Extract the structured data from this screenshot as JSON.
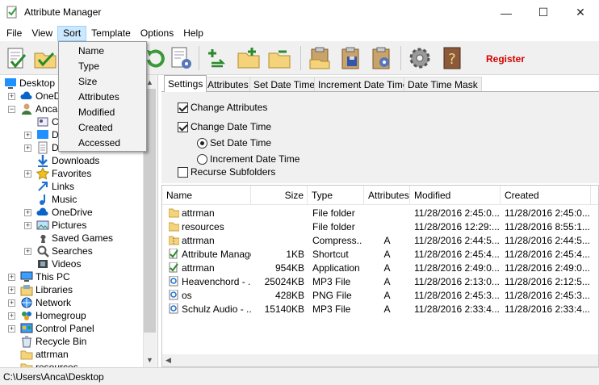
{
  "window": {
    "title": "Attribute Manager"
  },
  "menubar": [
    "File",
    "View",
    "Sort",
    "Template",
    "Options",
    "Help"
  ],
  "sort_menu": [
    "Name",
    "Type",
    "Size",
    "Attributes",
    "Modified",
    "Created",
    "Accessed"
  ],
  "toolbar": {
    "register_label": "Register"
  },
  "tree": [
    {
      "label": "Desktop"
    },
    {
      "label": "OneD"
    },
    {
      "label": "Anca"
    },
    {
      "label": "C"
    },
    {
      "label": "D"
    },
    {
      "label": "D"
    },
    {
      "label": "Downloads"
    },
    {
      "label": "Favorites"
    },
    {
      "label": "Links"
    },
    {
      "label": "Music"
    },
    {
      "label": "OneDrive"
    },
    {
      "label": "Pictures"
    },
    {
      "label": "Saved Games"
    },
    {
      "label": "Searches"
    },
    {
      "label": "Videos"
    },
    {
      "label": "This PC"
    },
    {
      "label": "Libraries"
    },
    {
      "label": "Network"
    },
    {
      "label": "Homegroup"
    },
    {
      "label": "Control Panel"
    },
    {
      "label": "Recycle Bin"
    },
    {
      "label": "attrman"
    },
    {
      "label": "resources"
    }
  ],
  "tabs": [
    "Settings",
    "Attributes",
    "Set Date Time",
    "Increment Date Time",
    "Date Time Mask"
  ],
  "settings": {
    "change_attributes": "Change Attributes",
    "change_date_time": "Change Date Time",
    "set_date_time": "Set Date Time",
    "increment_date_time": "Increment Date Time",
    "recurse_subfolders": "Recurse Subfolders"
  },
  "columns": [
    "Name",
    "Size",
    "Type",
    "Attributes",
    "Modified",
    "Created"
  ],
  "files": [
    {
      "name": "attrman",
      "size": "",
      "type": "File folder",
      "attr": "",
      "modified": "11/28/2016 2:45:0...",
      "created": "11/28/2016 2:45:0..."
    },
    {
      "name": "resources",
      "size": "",
      "type": "File folder",
      "attr": "",
      "modified": "11/28/2016 12:29:...",
      "created": "11/28/2016 8:55:1..."
    },
    {
      "name": "attrman",
      "size": "",
      "type": "Compress...",
      "attr": "A",
      "modified": "11/28/2016 2:44:5...",
      "created": "11/28/2016 2:44:5..."
    },
    {
      "name": "Attribute Manager",
      "size": "1KB",
      "type": "Shortcut",
      "attr": "A",
      "modified": "11/28/2016 2:45:4...",
      "created": "11/28/2016 2:45:4..."
    },
    {
      "name": "attrman",
      "size": "954KB",
      "type": "Application",
      "attr": "A",
      "modified": "11/28/2016 2:49:0...",
      "created": "11/28/2016 2:49:0..."
    },
    {
      "name": "Heavenchord - ...",
      "size": "25024KB",
      "type": "MP3 File",
      "attr": "A",
      "modified": "11/28/2016 2:13:0...",
      "created": "11/28/2016 2:12:5..."
    },
    {
      "name": "os",
      "size": "428KB",
      "type": "PNG File",
      "attr": "A",
      "modified": "11/28/2016 2:45:3...",
      "created": "11/28/2016 2:45:3..."
    },
    {
      "name": "Schulz Audio - ...",
      "size": "15140KB",
      "type": "MP3 File",
      "attr": "A",
      "modified": "11/28/2016 2:33:4...",
      "created": "11/28/2016 2:33:4..."
    }
  ],
  "status": {
    "path": "C:\\Users\\Anca\\Desktop"
  },
  "colors": {
    "register": "#d40000",
    "menu_highlight": "#cce8ff",
    "folder": "#f5d37a"
  }
}
